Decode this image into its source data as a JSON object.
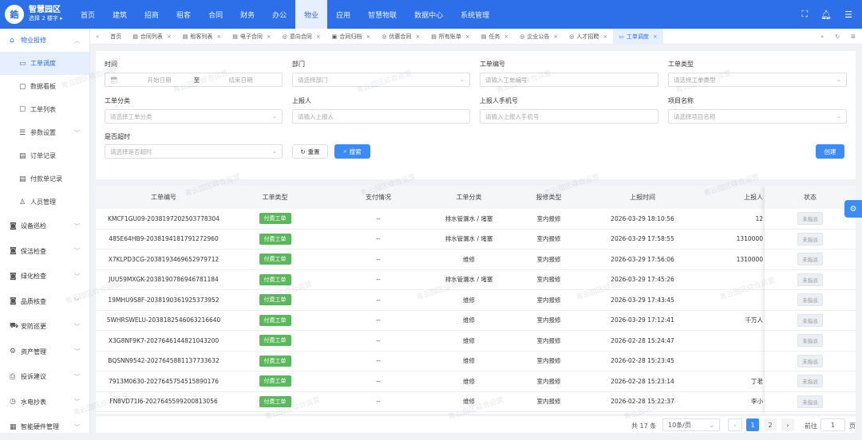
{
  "app": {
    "name": "智慧园区",
    "building": "选择 2 楼字 ▸",
    "logo_letter": "鋯"
  },
  "nav": [
    "首页",
    "建筑",
    "招商",
    "租客",
    "合同",
    "财务",
    "办公",
    "物业",
    "应用",
    "智慧物联",
    "数据中心",
    "系统管理"
  ],
  "nav_active": "物业",
  "sidebar": {
    "group": "物业报修",
    "items": [
      {
        "label": "工单调度",
        "icon": "dispatch-icon",
        "active": true
      },
      {
        "label": "数据看板",
        "icon": "folder-icon"
      },
      {
        "label": "工单列表",
        "icon": "list-icon"
      },
      {
        "label": "参数设置",
        "icon": "settings-icon",
        "arrow": true
      },
      {
        "label": "订单记录",
        "icon": "order-icon"
      },
      {
        "label": "付款单记录",
        "icon": "payment-icon"
      },
      {
        "label": "人员管理",
        "icon": "user-icon"
      }
    ],
    "modules": [
      {
        "label": "设备巡检",
        "icon": "camera-icon"
      },
      {
        "label": "保洁检查",
        "icon": "camera-icon"
      },
      {
        "label": "绿化检查",
        "icon": "camera-icon"
      },
      {
        "label": "品质核查",
        "icon": "camera-icon"
      },
      {
        "label": "安防巡更",
        "icon": "car-icon"
      },
      {
        "label": "资产管理",
        "icon": "asset-icon"
      },
      {
        "label": "投诉建议",
        "icon": "print-icon"
      },
      {
        "label": "水电抄表",
        "icon": "clock-icon"
      },
      {
        "label": "智能硬件管理",
        "icon": "calendar-icon"
      }
    ]
  },
  "tabs": [
    {
      "label": "首页"
    },
    {
      "label": "合同列表"
    },
    {
      "label": "租客列表"
    },
    {
      "label": "电子合同"
    },
    {
      "label": "意向合同"
    },
    {
      "label": "合同归档"
    },
    {
      "label": "优惠合同"
    },
    {
      "label": "所有账单"
    },
    {
      "label": "任务"
    },
    {
      "label": "企业公告"
    },
    {
      "label": "人才招聘"
    },
    {
      "label": "工单调度",
      "active": true
    }
  ],
  "filters": {
    "time_label": "时间",
    "start_placeholder": "开始日期",
    "to": "至",
    "end_placeholder": "结束日期",
    "dept_label": "部门",
    "dept_placeholder": "请选择部门",
    "order_no_label": "工单编号",
    "order_no_placeholder": "请输入工单编号",
    "order_type_label": "工单类型",
    "order_type_placeholder": "请选择工单类型",
    "category_label": "工单分类",
    "category_placeholder": "请选择工单分类",
    "reporter_label": "上报人",
    "reporter_placeholder": "请输入上报人",
    "phone_label": "上报人手机号",
    "phone_placeholder": "请输入上报人手机号",
    "project_label": "项目名称",
    "project_placeholder": "请选择项目名称",
    "overdue_label": "是否超时",
    "overdue_placeholder": "请选择是否超时",
    "reset": "重置",
    "search": "搜索",
    "create": "创建"
  },
  "table": {
    "headers": [
      "工单编号",
      "工单类型",
      "支付情况",
      "工单分类",
      "报修类型",
      "上报时间",
      "上报人",
      "状态"
    ],
    "rows": [
      {
        "no": "KMCF1GU09-2038197202503778304",
        "type": "付费工单",
        "pay": "--",
        "cat": "排水管漏水 / 堵塞",
        "rtype": "室内报修",
        "time": "2026-03-29 18:10:56",
        "reporter": "12",
        "status": "未指派"
      },
      {
        "no": "485E64HB9-2038194181791272960",
        "type": "付费工单",
        "pay": "--",
        "cat": "排水管漏水 / 堵塞",
        "rtype": "室内报修",
        "time": "2026-03-29 17:58:55",
        "reporter": "1310000",
        "status": "未指派"
      },
      {
        "no": "X7KLPD3CG-2038193469652979712",
        "type": "付费工单",
        "pay": "--",
        "cat": "维修",
        "rtype": "室内报修",
        "time": "2026-03-29 17:56:06",
        "reporter": "1310000",
        "status": "未指派"
      },
      {
        "no": "JUU59MXGK-2038190786946781184",
        "type": "付费工单",
        "pay": "--",
        "cat": "排水管漏水 / 堵塞",
        "rtype": "室内报修",
        "time": "2026-03-29 17:45:26",
        "reporter": "",
        "status": "未指派"
      },
      {
        "no": "19MHU9S8F-2038190361925373952",
        "type": "付费工单",
        "pay": "--",
        "cat": "维修",
        "rtype": "室内报修",
        "time": "2026-03-29 17:43:45",
        "reporter": "",
        "status": "未指派"
      },
      {
        "no": "5WHRSWELU-2038182546063216640",
        "type": "付费工单",
        "pay": "--",
        "cat": "维修",
        "rtype": "室内报修",
        "time": "2026-03-29 17:12:41",
        "reporter": "千万人",
        "status": "未指派"
      },
      {
        "no": "X3G8NF9K7-2027646144821043200",
        "type": "付费工单",
        "pay": "--",
        "cat": "维修",
        "rtype": "室内报修",
        "time": "2026-02-28 15:24:47",
        "reporter": "",
        "status": "未指派"
      },
      {
        "no": "BQSNN9542-2027645881137733632",
        "type": "付费工单",
        "pay": "--",
        "cat": "维修",
        "rtype": "室内报修",
        "time": "2026-02-28 15:23:45",
        "reporter": "",
        "status": "未指派"
      },
      {
        "no": "7913M0630-2027645754515890176",
        "type": "付费工单",
        "pay": "--",
        "cat": "维修",
        "rtype": "室内报修",
        "time": "2026-02-28 15:23:14",
        "reporter": "丁老",
        "status": "未指派"
      },
      {
        "no": "FN8VD71I6-2027645599200813056",
        "type": "付费工单",
        "pay": "--",
        "cat": "维修",
        "rtype": "室内报修",
        "time": "2026-02-28 15:22:37",
        "reporter": "李小",
        "status": "未指派"
      }
    ]
  },
  "pager": {
    "total": "共 17 条",
    "page_size": "10条/页",
    "pages": [
      "1",
      "2"
    ],
    "current": "1",
    "goto": "前往",
    "goto_value": "1",
    "unit": "页"
  },
  "watermark": "青云园区综合运营",
  "colors": {
    "primary": "#2d6fe8",
    "accent": "#3b8cf7",
    "tag_green": "#5cb85c"
  }
}
